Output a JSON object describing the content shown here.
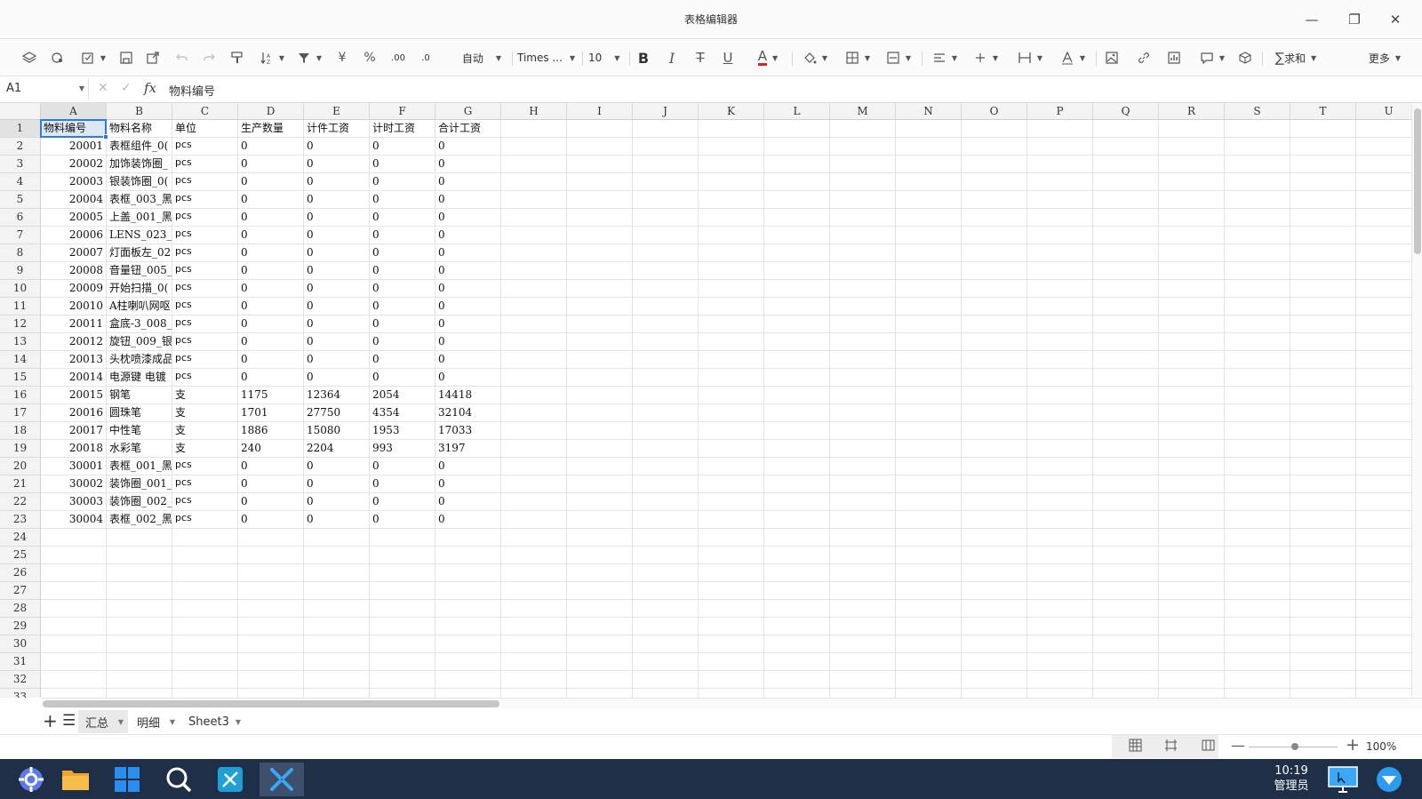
{
  "window": {
    "title": "表格编辑器",
    "minimize_glyph": "—",
    "restore_glyph": "❐",
    "close_glyph": "✕"
  },
  "toolbar": {
    "font_size_mode": "自动",
    "font_family": "Times ...",
    "font_size": "10",
    "currency_label": "¥",
    "percent_label": "%",
    "dec_increase_label": ".00",
    "dec_decrease_label": ".0",
    "bold_label": "B",
    "italic_label": "I",
    "strike_label": "T",
    "underline_label": "U",
    "font_color_label": "A",
    "sum_label": "求和",
    "more_label": "更多",
    "accent_color": "#2d7be0",
    "font_color_bar": "#e02020"
  },
  "formula_bar": {
    "cell_ref": "A1",
    "fx_label": "fx",
    "content": "物料编号"
  },
  "columns": [
    "A",
    "B",
    "C",
    "D",
    "E",
    "F",
    "G",
    "H",
    "I",
    "J",
    "K",
    "L",
    "M",
    "N",
    "O",
    "P",
    "Q",
    "R",
    "S",
    "T",
    "U"
  ],
  "row_numbers": [
    "1",
    "2",
    "3",
    "4",
    "5",
    "6",
    "7",
    "8",
    "9",
    "10",
    "11",
    "12",
    "13",
    "14",
    "15",
    "16",
    "17",
    "18",
    "19",
    "20",
    "21",
    "22",
    "23",
    "24",
    "25",
    "26",
    "27",
    "28",
    "29",
    "30",
    "31",
    "32",
    "33"
  ],
  "table": {
    "headers": [
      "物料编号",
      "物料名称",
      "单位",
      "生产数量",
      "计件工资",
      "计时工资",
      "合计工资"
    ],
    "rows": [
      [
        "20001",
        "表框组件_0(",
        "pcs",
        "0",
        "0",
        "0",
        "0"
      ],
      [
        "20002",
        "加饰装饰圈_",
        "pcs",
        "0",
        "0",
        "0",
        "0"
      ],
      [
        "20003",
        "银装饰圈_0(",
        "pcs",
        "0",
        "0",
        "0",
        "0"
      ],
      [
        "20004",
        "表框_003_黑",
        "pcs",
        "0",
        "0",
        "0",
        "0"
      ],
      [
        "20005",
        "上盖_001_黑",
        "pcs",
        "0",
        "0",
        "0",
        "0"
      ],
      [
        "20006",
        "LENS_023_我",
        "pcs",
        "0",
        "0",
        "0",
        "0"
      ],
      [
        "20007",
        "灯面板左_02",
        "pcs",
        "0",
        "0",
        "0",
        "0"
      ],
      [
        "20008",
        "音量钮_005_",
        "pcs",
        "0",
        "0",
        "0",
        "0"
      ],
      [
        "20009",
        "开始扫描_0(",
        "pcs",
        "0",
        "0",
        "0",
        "0"
      ],
      [
        "20010",
        "A柱喇叭网呕",
        "pcs",
        "0",
        "0",
        "0",
        "0"
      ],
      [
        "20011",
        "盒底-3_008_",
        "pcs",
        "0",
        "0",
        "0",
        "0"
      ],
      [
        "20012",
        "旋钮_009_银",
        "pcs",
        "0",
        "0",
        "0",
        "0"
      ],
      [
        "20013",
        "头枕喷漆成品",
        "pcs",
        "0",
        "0",
        "0",
        "0"
      ],
      [
        "20014",
        "电源键 电镀",
        "pcs",
        "0",
        "0",
        "0",
        "0"
      ],
      [
        "20015",
        "钢笔",
        "支",
        "1175",
        "12364",
        "2054",
        "14418"
      ],
      [
        "20016",
        "圆珠笔",
        "支",
        "1701",
        "27750",
        "4354",
        "32104"
      ],
      [
        "20017",
        "中性笔",
        "支",
        "1886",
        "15080",
        "1953",
        "17033"
      ],
      [
        "20018",
        "水彩笔",
        "支",
        "240",
        "2204",
        "993",
        "3197"
      ],
      [
        "30001",
        "表框_001_黑",
        "pcs",
        "0",
        "0",
        "0",
        "0"
      ],
      [
        "30002",
        "装饰圈_001_",
        "pcs",
        "0",
        "0",
        "0",
        "0"
      ],
      [
        "30003",
        "装饰圈_002_",
        "pcs",
        "0",
        "0",
        "0",
        "0"
      ],
      [
        "30004",
        "表框_002_黑",
        "pcs",
        "0",
        "0",
        "0",
        "0"
      ]
    ]
  },
  "sheets": [
    {
      "name": "汇总",
      "active": true
    },
    {
      "name": "明细",
      "active": false
    },
    {
      "name": "Sheet3",
      "active": false
    }
  ],
  "status": {
    "zoom": "100%",
    "zoom_out": "—",
    "zoom_in": "+"
  },
  "taskbar": {
    "time": "10:19",
    "user": "管理员",
    "taskbar_color": "#1f2f47"
  }
}
